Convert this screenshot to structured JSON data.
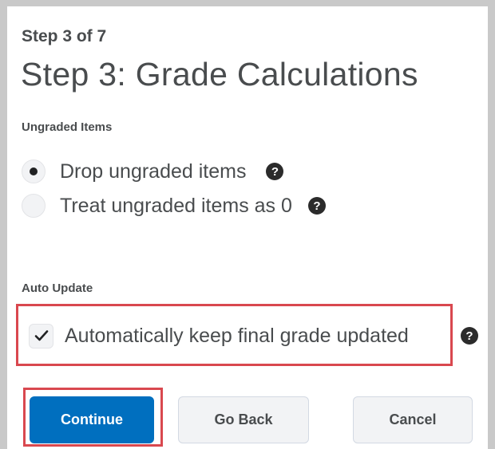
{
  "header": {
    "step_caption": "Step 3 of 7",
    "title": "Step 3: Grade Calculations"
  },
  "ungraded": {
    "section_label": "Ungraded Items",
    "options": [
      {
        "label": "Drop ungraded items",
        "selected": true
      },
      {
        "label": "Treat ungraded items as 0",
        "selected": false
      }
    ]
  },
  "auto_update": {
    "section_label": "Auto Update",
    "checkbox_label": "Automatically keep final grade updated",
    "checked": true
  },
  "help_icon_glyph": "?",
  "buttons": {
    "continue_label": "Continue",
    "go_back_label": "Go Back",
    "cancel_label": "Cancel"
  },
  "colors": {
    "primary": "#006fbf",
    "highlight": "#d9484f",
    "text": "#494c4e"
  },
  "icons": {
    "help": "question-circle-icon",
    "checkmark": "checkmark-icon",
    "radio_dot": "radio-selected-dot"
  }
}
